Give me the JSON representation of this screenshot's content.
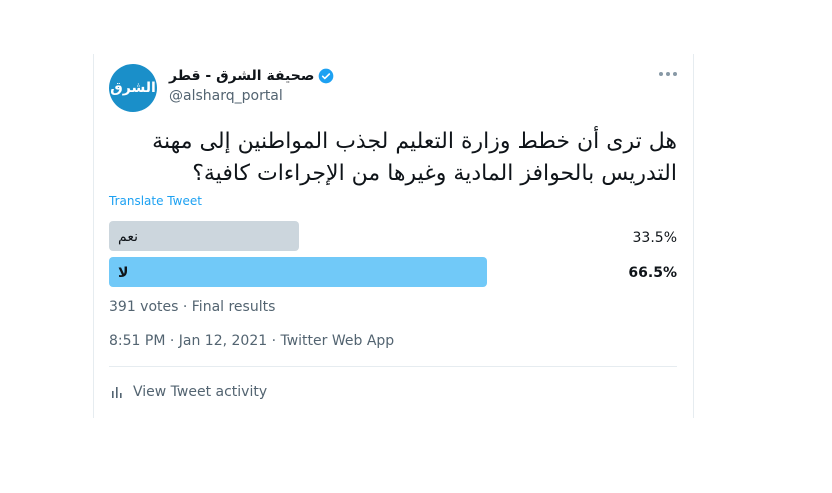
{
  "tweet": {
    "avatar_text": "الشرق",
    "display_name": "صحيفة الشرق - قطر",
    "handle": "@alsharq_portal",
    "question": "هل ترى أن خطط وزارة التعليم لجذب المواطنين إلى مهنة التدريس بالحوافز المادية وغيرها من الإجراءات كافية؟",
    "translate_label": "Translate Tweet",
    "poll": {
      "options": [
        {
          "label": "نعم",
          "percent_text": "33.5%",
          "percent": 33.5
        },
        {
          "label": "لا",
          "percent_text": "66.5%",
          "percent": 66.5
        }
      ],
      "summary": "391 votes · Final results"
    },
    "timestamp": "8:51 PM · Jan 12, 2021 · Twitter Web App",
    "activity_label": "View Tweet activity"
  },
  "colors": {
    "accent": "#1da1f2",
    "winning_bar": "#71c9f8",
    "losing_bar": "#ccd6dd",
    "avatar_bg": "#1a8fc9"
  },
  "icons": [
    "verified-badge-icon",
    "more-dots-icon",
    "bar-chart-icon"
  ]
}
